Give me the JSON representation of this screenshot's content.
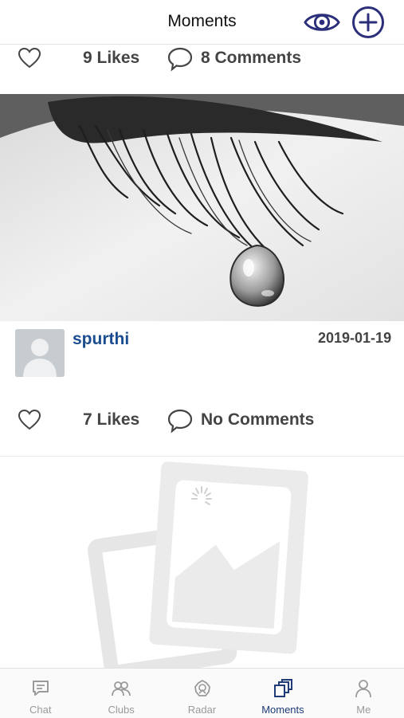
{
  "header": {
    "title": "Moments",
    "icons": [
      "eye-icon",
      "plus-circle-icon"
    ],
    "accent_color": "#2b2f7a"
  },
  "posts": [
    {
      "likes": "9 Likes",
      "comments": "8 Comments"
    },
    {
      "username": "spurthi",
      "date": "2019-01-19",
      "likes": "7 Likes",
      "comments": "No Comments"
    }
  ],
  "tabbar": {
    "items": [
      {
        "label": "Chat",
        "icon": "chat-icon"
      },
      {
        "label": "Clubs",
        "icon": "clubs-icon"
      },
      {
        "label": "Radar",
        "icon": "radar-icon"
      },
      {
        "label": "Moments",
        "icon": "moments-icon",
        "active": true
      },
      {
        "label": "Me",
        "icon": "person-icon"
      }
    ],
    "active_color": "#1e3a78",
    "inactive_color": "#9a9a9a"
  }
}
